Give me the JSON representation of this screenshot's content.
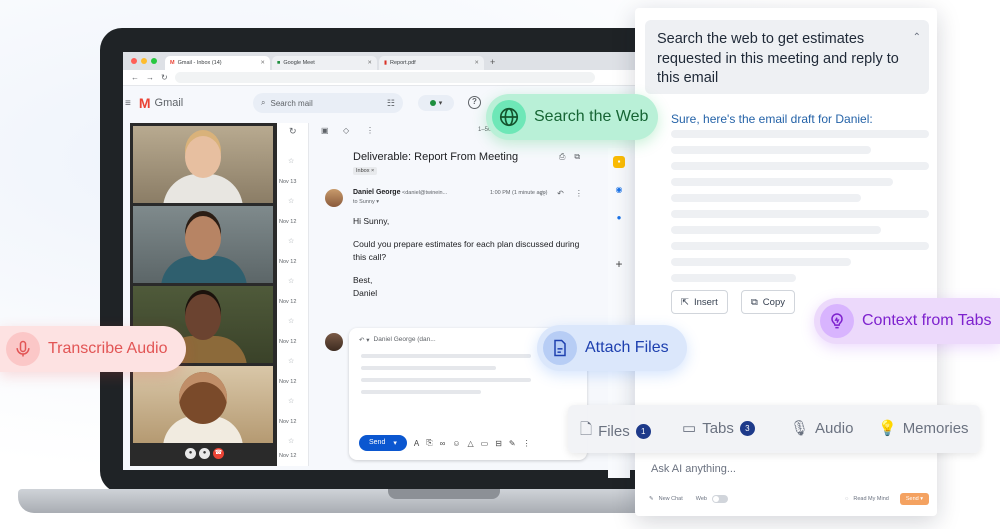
{
  "browser": {
    "tabs": [
      {
        "label": "Gmail - Inbox (14)",
        "icon": "gmail-icon"
      },
      {
        "label": "Google Meet",
        "icon": "meet-icon"
      },
      {
        "label": "Report.pdf",
        "icon": "pdf-icon"
      }
    ]
  },
  "gmail": {
    "app_name": "Gmail",
    "search_placeholder": "Search mail",
    "pagination_snippet": "1–50",
    "mail_dates": [
      "Nov 13",
      "Nov 12",
      "Nov 12",
      "Nov 12",
      "Nov 12",
      "Nov 12",
      "Nov 12",
      "Nov 12"
    ],
    "email": {
      "subject": "Deliverable: Report From Meeting",
      "label": "Inbox ×",
      "sender_name": "Daniel George",
      "sender_email": "<daniel@twinein...",
      "time": "1:00 PM (1 minute ago)",
      "to": "to Sunny ▾",
      "greeting": "Hi Sunny,",
      "body": "Could you prepare estimates for each plan discussed during this call?",
      "signoff": "Best,",
      "signature": "Daniel"
    },
    "reply": {
      "to": "Daniel George (dan...",
      "send_label": "Send"
    }
  },
  "ai_panel": {
    "prompt": "Search the web to get estimates requested in this meeting and reply to this email",
    "response_intro": "Sure, here's the email draft for Daniel:",
    "insert_label": "Insert",
    "copy_label": "Copy",
    "ask_placeholder": "Ask AI anything...",
    "new_chat_label": "New Chat",
    "web_label": "Web",
    "model_label": "Read My Mind",
    "send_label": "Send"
  },
  "chips": [
    {
      "label": "Files",
      "count": "1",
      "icon": "file-icon"
    },
    {
      "label": "Tabs",
      "count": "3",
      "icon": "monitor-icon"
    },
    {
      "label": "Audio",
      "icon": "microphone-icon"
    },
    {
      "label": "Memories",
      "icon": "lightbulb-icon"
    }
  ],
  "features": {
    "search_web": "Search the Web",
    "transcribe": "Transcribe Audio",
    "attach": "Attach Files",
    "context": "Context from Tabs"
  },
  "colors": {
    "web_green": "#b9f0d7",
    "transcribe_red": "#fde2e2",
    "attach_blue": "#dbe7fb",
    "context_purple": "#ecd9fb",
    "gmail_send_blue": "#0b57d0"
  }
}
